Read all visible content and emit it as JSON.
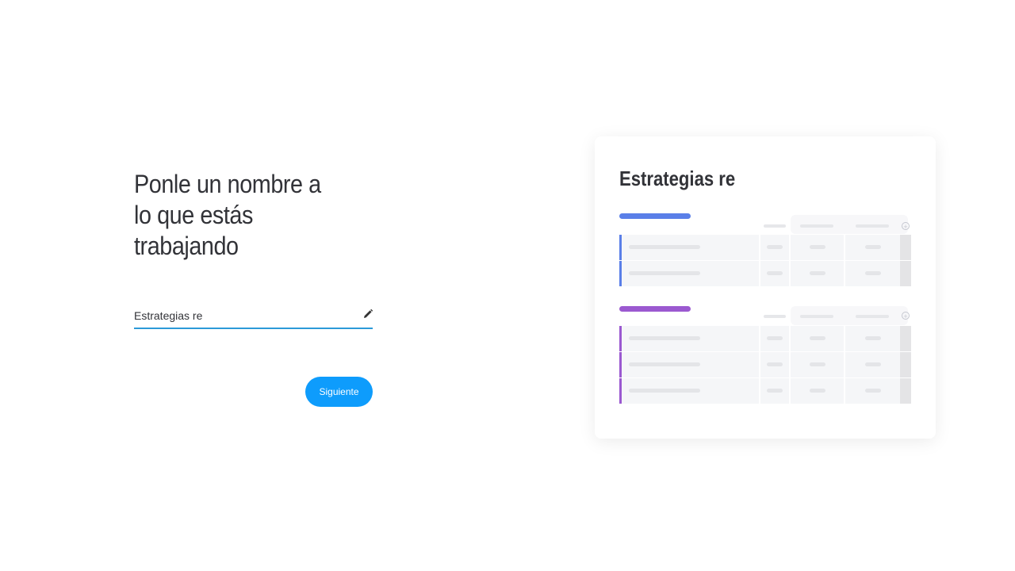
{
  "onboarding": {
    "heading_line1": "Ponle un nombre a",
    "heading_line2": "lo que estás",
    "heading_line3": "trabajando",
    "name_input_value": "Estrategias re",
    "next_button_label": "Siguiente"
  },
  "preview": {
    "board_title": "Estrategias re"
  },
  "colors": {
    "primary": "#0e9cfc",
    "input_underline": "#2c9ad8",
    "group1": "#5a7fe8",
    "group2": "#9b59d0",
    "text": "#323338"
  },
  "icons": {
    "edit": "pencil-icon",
    "add_column": "plus-circle-icon"
  }
}
